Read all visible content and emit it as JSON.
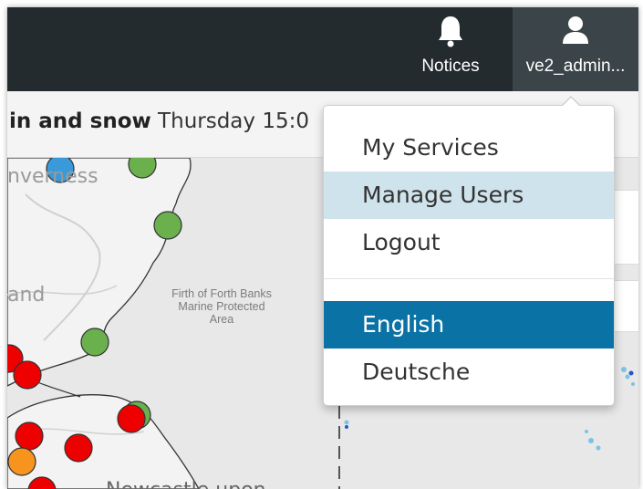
{
  "nav": {
    "notices_label": "Notices",
    "user_label": "ve2_admin..."
  },
  "weather": {
    "condition": "in and snow",
    "day_time": " Thursday 15:0"
  },
  "map": {
    "labels": {
      "inverness": "nverness",
      "land": "and",
      "mpa_line1": "Firth of Forth Banks",
      "mpa_line2": "Marine Protected",
      "mpa_line3": "Area",
      "newcastle": "Newcastle upon"
    },
    "marker_colors": {
      "blue": "#3a9ad9",
      "green": "#6ab04c",
      "red": "#ee0000",
      "orange": "#f7941d"
    }
  },
  "user_menu": {
    "items": [
      {
        "label": "My Services",
        "state": "normal"
      },
      {
        "label": "Manage Users",
        "state": "hover"
      },
      {
        "label": "Logout",
        "state": "normal"
      }
    ],
    "languages": [
      {
        "label": "English",
        "state": "selected"
      },
      {
        "label": "Deutsche",
        "state": "normal"
      }
    ]
  },
  "colors": {
    "topbar": "#232b2f",
    "user_tab": "#3b4448",
    "menu_hover": "#cfe3ec",
    "menu_selected": "#0a72a4"
  }
}
